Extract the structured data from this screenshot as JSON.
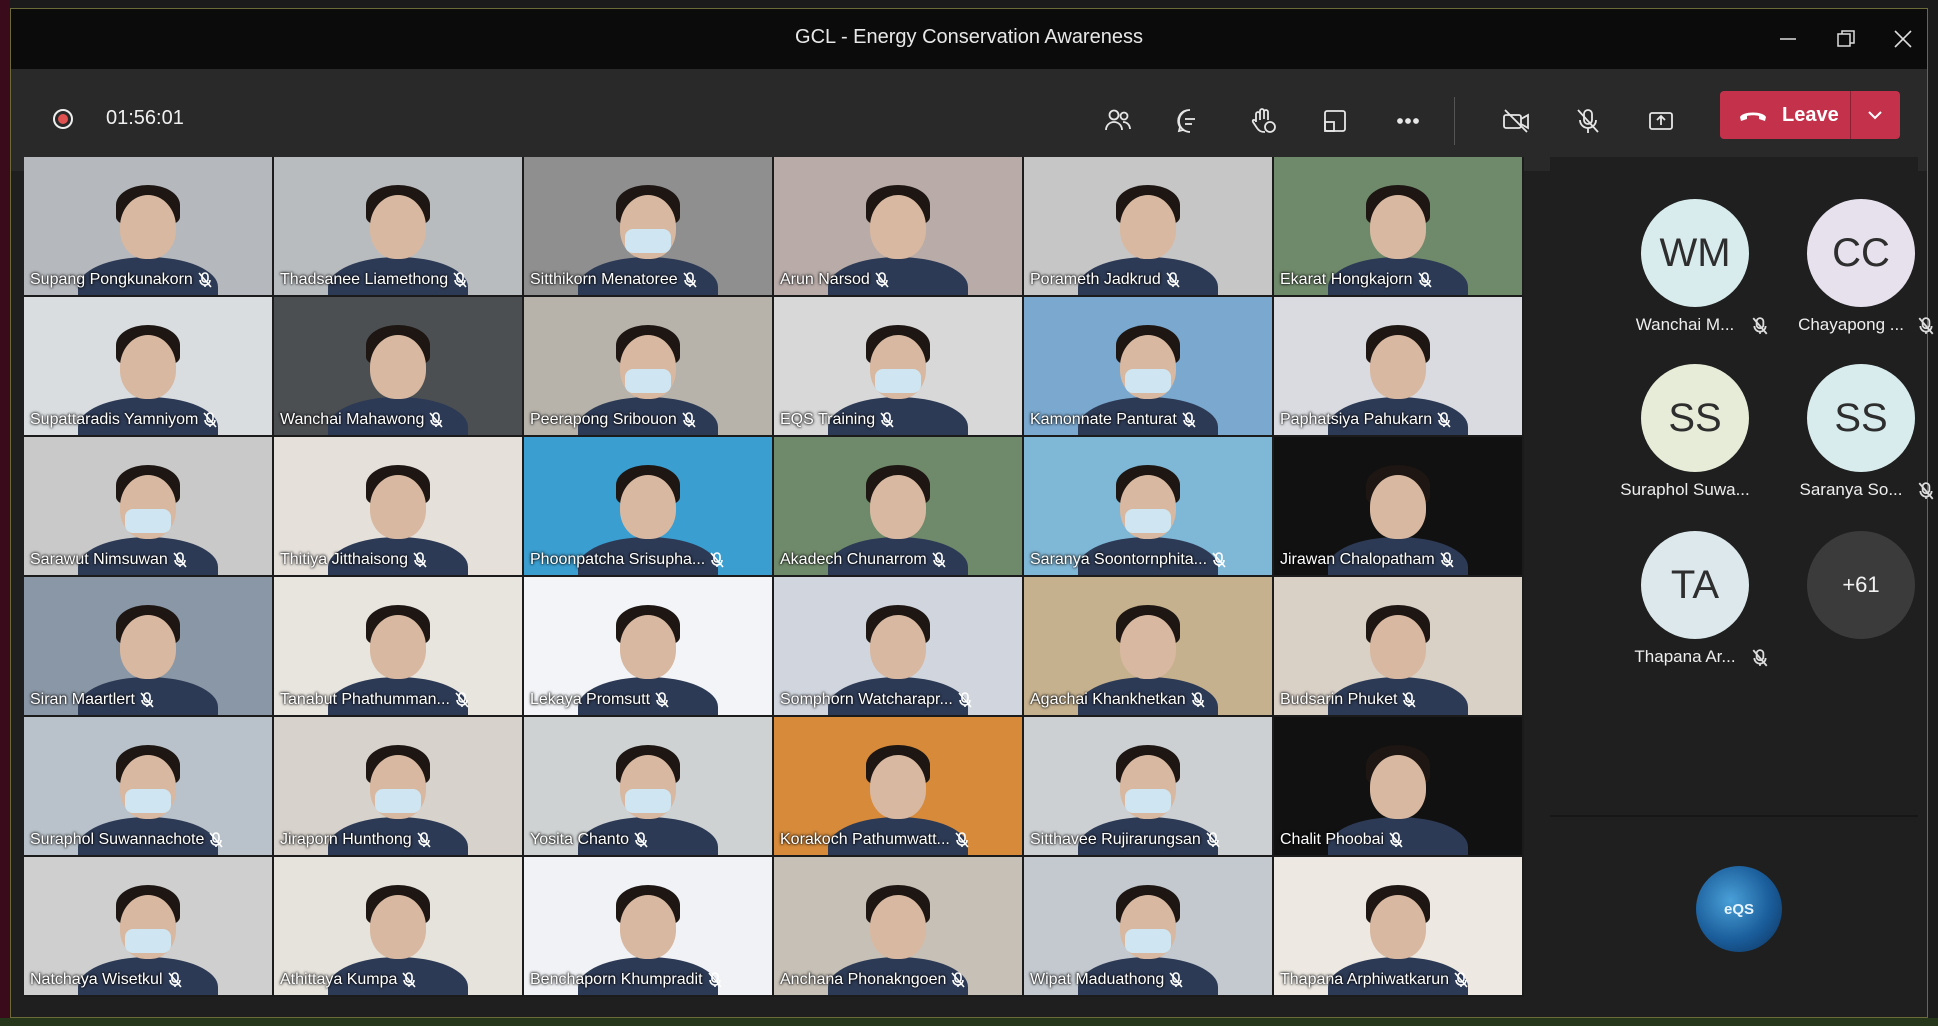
{
  "window": {
    "title": "GCL - Energy Conservation Awareness"
  },
  "meeting": {
    "timer": "01:56:01",
    "leave_label": "Leave",
    "logo_text": "eQS"
  },
  "participants": [
    {
      "name": "Supang Pongkunakorn",
      "bg": "#b5b8bd",
      "mask": false
    },
    {
      "name": "Thadsanee Liamethong",
      "bg": "#b9bcbf",
      "mask": false
    },
    {
      "name": "Sitthikorn Menatoree",
      "bg": "#8f8f8f",
      "mask": true
    },
    {
      "name": "Arun Narsod",
      "bg": "#b8aba8",
      "mask": false
    },
    {
      "name": "Porameth Jadkrud",
      "bg": "#c6c6c6",
      "mask": false
    },
    {
      "name": "Ekarat Hongkajorn",
      "bg": "#6f8a6a",
      "mask": false
    },
    {
      "name": "Supattaradis Yamniyom",
      "bg": "#d9dde0",
      "mask": false
    },
    {
      "name": "Wanchai Mahawong",
      "bg": "#4c4f52",
      "mask": false
    },
    {
      "name": "Peerapong Sribouon",
      "bg": "#b7b3ab",
      "mask": true
    },
    {
      "name": "EQS Training",
      "bg": "#d8d8d8",
      "mask": true
    },
    {
      "name": "Kamonnate Panturat",
      "bg": "#7aa8cf",
      "mask": true
    },
    {
      "name": "Paphatsiya Pahukarn",
      "bg": "#d9dbe0",
      "mask": false
    },
    {
      "name": "Sarawut Nimsuwan",
      "bg": "#c9c9c9",
      "mask": true
    },
    {
      "name": "Thitiya Jitthaisong",
      "bg": "#e5e0da",
      "mask": false
    },
    {
      "name": "Phoonpatcha Srisupha...",
      "bg": "#3a9ed0",
      "mask": false
    },
    {
      "name": "Akadech Chunarrom",
      "bg": "#6f8a6a",
      "mask": false
    },
    {
      "name": "Saranya Soontornphita...",
      "bg": "#7fb7d6",
      "mask": true
    },
    {
      "name": "Jirawan Chalopatham",
      "bg": "#111111",
      "mask": false
    },
    {
      "name": "Siran Maartlert",
      "bg": "#8a97a6",
      "mask": false
    },
    {
      "name": "Tanabut Phathumman...",
      "bg": "#e8e4de",
      "mask": false
    },
    {
      "name": "Lekaya Promsutt",
      "bg": "#f2f4f7",
      "mask": false
    },
    {
      "name": "Somphorn Watcharapr...",
      "bg": "#d0d5de",
      "mask": false
    },
    {
      "name": "Agachai Khankhetkan",
      "bg": "#c6b18e",
      "mask": false
    },
    {
      "name": "Budsarin Phuket",
      "bg": "#d9d0c6",
      "mask": false
    },
    {
      "name": "Suraphol Suwannachote",
      "bg": "#b9c2ca",
      "mask": true
    },
    {
      "name": "Jiraporn Hunthong",
      "bg": "#d7d2cb",
      "mask": true
    },
    {
      "name": "Yosita Chanto",
      "bg": "#cfd2d3",
      "mask": true
    },
    {
      "name": "Korakoch Pathumwatt...",
      "bg": "#d68a3a",
      "mask": false
    },
    {
      "name": "Sitthavee Rujirarungsan",
      "bg": "#cdd0d3",
      "mask": true
    },
    {
      "name": "Chalit Phoobai",
      "bg": "#111111",
      "mask": false
    },
    {
      "name": "Natchaya Wisetkul",
      "bg": "#cfcfcf",
      "mask": true
    },
    {
      "name": "Athittaya Kumpa",
      "bg": "#e6e3dc",
      "mask": false
    },
    {
      "name": "Benchaporn Khumpradit",
      "bg": "#f0f2f5",
      "mask": false
    },
    {
      "name": "Anchana Phonakngoen",
      "bg": "#c6c0b6",
      "mask": false
    },
    {
      "name": "Wipat Maduathong",
      "bg": "#c3c9cf",
      "mask": true
    },
    {
      "name": "Thapana Arphiwatkarun",
      "bg": "#ede9e2",
      "mask": false
    }
  ],
  "side_participants": [
    {
      "initials": "WM",
      "name": "Wanchai M...",
      "color": "#d8ecee"
    },
    {
      "initials": "CC",
      "name": "Chayapong ...",
      "color": "#e7e1ee"
    },
    {
      "initials": "SS",
      "name": "Suraphol Suwa...",
      "color": "#e6ecd8"
    },
    {
      "initials": "SS",
      "name": "Saranya So...",
      "color": "#d8ecee"
    },
    {
      "initials": "TA",
      "name": "Thapana Ar...",
      "color": "#dce8ec"
    },
    {
      "initials": "+61",
      "name": "",
      "color": "#3b3b3b"
    }
  ]
}
